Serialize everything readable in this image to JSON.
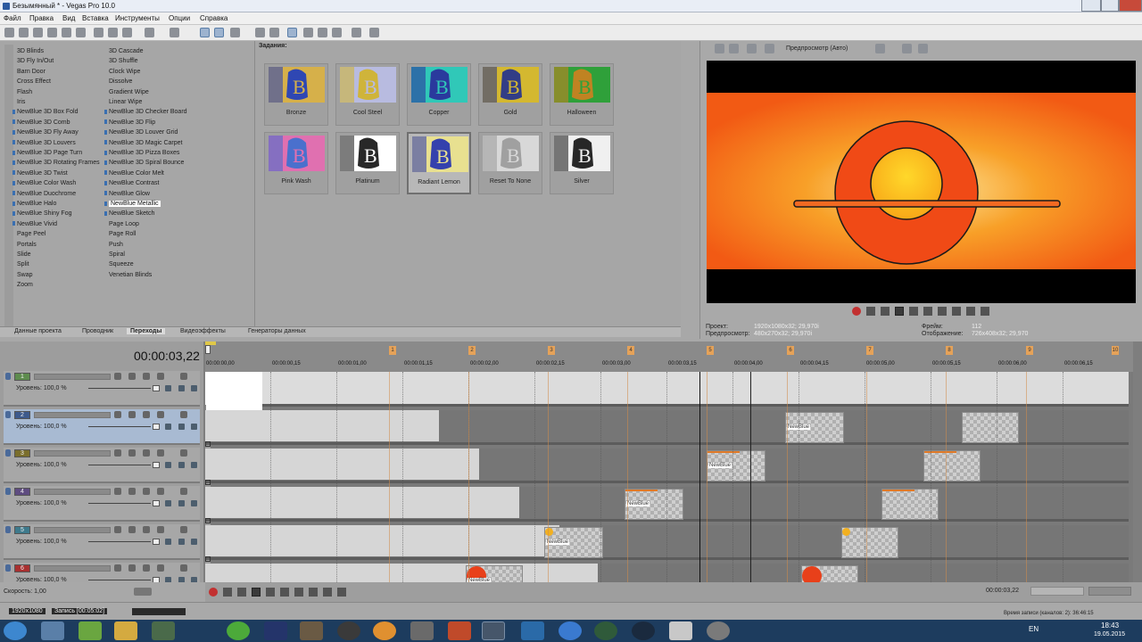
{
  "window": {
    "title": "Безымянный * - Vegas Pro 10.0"
  },
  "menu": [
    "Файл",
    "Правка",
    "Вид",
    "Вставка",
    "Инструменты",
    "Опции",
    "Справка"
  ],
  "transitions_col1": [
    "3D Blinds",
    "3D Fly In/Out",
    "Barn Door",
    "Cross Effect",
    "Flash",
    "Iris",
    "NewBlue 3D Box Fold",
    "NewBlue 3D Comb",
    "NewBlue 3D Fly Away",
    "NewBlue 3D Louvers",
    "NewBlue 3D Page Turn",
    "NewBlue 3D Rotating Frames",
    "NewBlue 3D Twist",
    "NewBlue Color Wash",
    "NewBlue Duochrome",
    "NewBlue Halo",
    "NewBlue Shiny Fog",
    "NewBlue Vivid",
    "Page Peel",
    "Portals",
    "Slide",
    "Split",
    "Swap",
    "Zoom"
  ],
  "transitions_col2": [
    "3D Cascade",
    "3D Shuffle",
    "Clock Wipe",
    "Dissolve",
    "Gradient Wipe",
    "Linear Wipe",
    "NewBlue 3D Checker Board",
    "NewBlue 3D Flip",
    "NewBlue 3D Louver Grid",
    "NewBlue 3D Magic Carpet",
    "NewBlue 3D Pizza Boxes",
    "NewBlue 3D Spiral Bounce",
    "NewBlue Color Melt",
    "NewBlue Contrast",
    "NewBlue Glow",
    "NewBlue Metallic",
    "NewBlue Sketch",
    "Page Loop",
    "Page Roll",
    "Push",
    "Spiral",
    "Squeeze",
    "Venetian Blinds"
  ],
  "presets": {
    "header": "Задания:",
    "items": [
      {
        "label": "Bronze",
        "bg": "#d6b04a",
        "fg": "#1d3cbf"
      },
      {
        "label": "Cool Steel",
        "bg": "#b8bbe0",
        "fg": "#d2b428"
      },
      {
        "label": "Copper",
        "bg": "#30c8b8",
        "fg": "#2a2a9a"
      },
      {
        "label": "Gold",
        "bg": "#d4b830",
        "fg": "#203090"
      },
      {
        "label": "Halloween",
        "bg": "#2fa03a",
        "fg": "#d08020"
      },
      {
        "label": "Pink Wash",
        "bg": "#e070b0",
        "fg": "#3a70d0"
      },
      {
        "label": "Platinum",
        "bg": "#ffffff",
        "fg": "#111111"
      },
      {
        "label": "Radiant Lemon",
        "bg": "#e8e090",
        "fg": "#2030b0"
      },
      {
        "label": "Reset To None",
        "bg": "#d8d8d8",
        "fg": "#9a9a9a"
      },
      {
        "label": "Silver",
        "bg": "#f0f0f0",
        "fg": "#111111"
      }
    ]
  },
  "tabs": [
    "Данные проекта",
    "Проводник",
    "Переходы",
    "Видеоэффекты",
    "Генераторы данных"
  ],
  "preview": {
    "mode": "Предпросмотр (Авто)",
    "project_label": "Проект:",
    "project_value": "1920x1080x32; 29,970i",
    "preview_label": "Предпросмотр:",
    "preview_value": "480x270x32; 29,970i",
    "frame_label": "Фрейм:",
    "frame_value": "112",
    "display_label": "Отображение:",
    "display_value": "726x408x32; 29,970"
  },
  "timeline": {
    "timecode": "00:00:03,22",
    "ruler": [
      "00:00:00,00",
      "00:00:00,15",
      "00:00:01,00",
      "00:00:01,15",
      "00:00:02,00",
      "00:00:02,15",
      "00:00:03,00",
      "00:00:03,15",
      "00:00:04,00",
      "00:00:04,15",
      "00:00:05,00",
      "00:00:05,15",
      "00:00:06,00",
      "00:00:06,15"
    ],
    "markers": [
      "1",
      "2",
      "3",
      "4",
      "5",
      "6",
      "7",
      "8",
      "9",
      "10"
    ],
    "tracks": [
      {
        "num": "1",
        "color": "#5e8c4e",
        "level_label": "Уровень:",
        "level": "100,0 %"
      },
      {
        "num": "2",
        "color": "#3e5a8c",
        "level_label": "Уровень:",
        "level": "100,0 %"
      },
      {
        "num": "3",
        "color": "#7a6e2c",
        "level_label": "Уровень:",
        "level": "100,0 %"
      },
      {
        "num": "4",
        "color": "#5e4c80",
        "level_label": "Уровень:",
        "level": "100,0 %"
      },
      {
        "num": "5",
        "color": "#3e7a8c",
        "level_label": "Уровень:",
        "level": "100,0 %"
      },
      {
        "num": "6",
        "color": "#a83030",
        "level_label": "Уровень:",
        "level": "100,0 %"
      }
    ],
    "clip_label": "NewBlue",
    "speed": "Скорость: 1,00",
    "foot_time": "00:00:03,22"
  },
  "status": {
    "res": "1920x1080",
    "rec": "Запись [00:05:02]",
    "rec_time": "Время записи (каналов: 2): 36:46:15"
  },
  "taskbar": {
    "lang": "EN",
    "time": "18:43",
    "date": "19.05.2015"
  }
}
